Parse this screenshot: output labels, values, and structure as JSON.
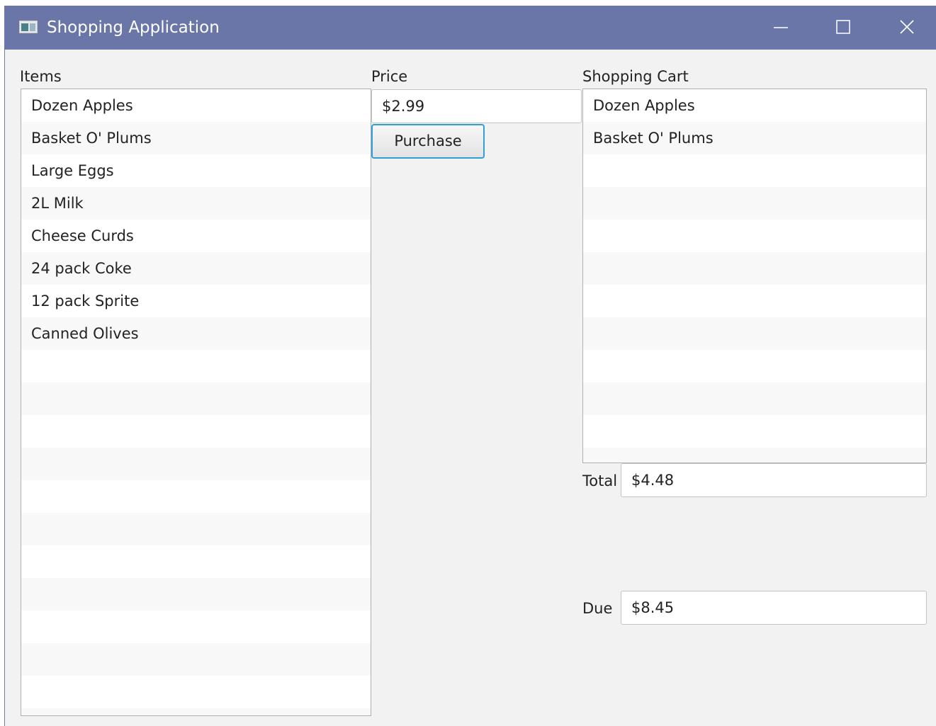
{
  "window": {
    "title": "Shopping Application",
    "icon": "app-window-icon",
    "controls": [
      "minimize-icon",
      "maximize-icon",
      "close-icon"
    ]
  },
  "items": {
    "label": "Items",
    "list": [
      "Dozen Apples",
      "Basket O' Plums",
      "Large Eggs",
      "2L Milk",
      "Cheese Curds",
      "24 pack Coke",
      "12 pack Sprite",
      "Canned Olives"
    ]
  },
  "price": {
    "label": "Price",
    "value": "$2.99",
    "purchase_label": "Purchase"
  },
  "cart": {
    "label": "Shopping Cart",
    "list": [
      "Dozen Apples",
      "Basket O' Plums"
    ]
  },
  "totals": {
    "total_label": "Total",
    "total_value": "$4.48",
    "due_label": "Due",
    "due_value": "$8.45"
  },
  "colors": {
    "titlebar": "#6b76a8",
    "focus_border": "#2f9fd8",
    "window_bg": "#f2f2f2"
  }
}
